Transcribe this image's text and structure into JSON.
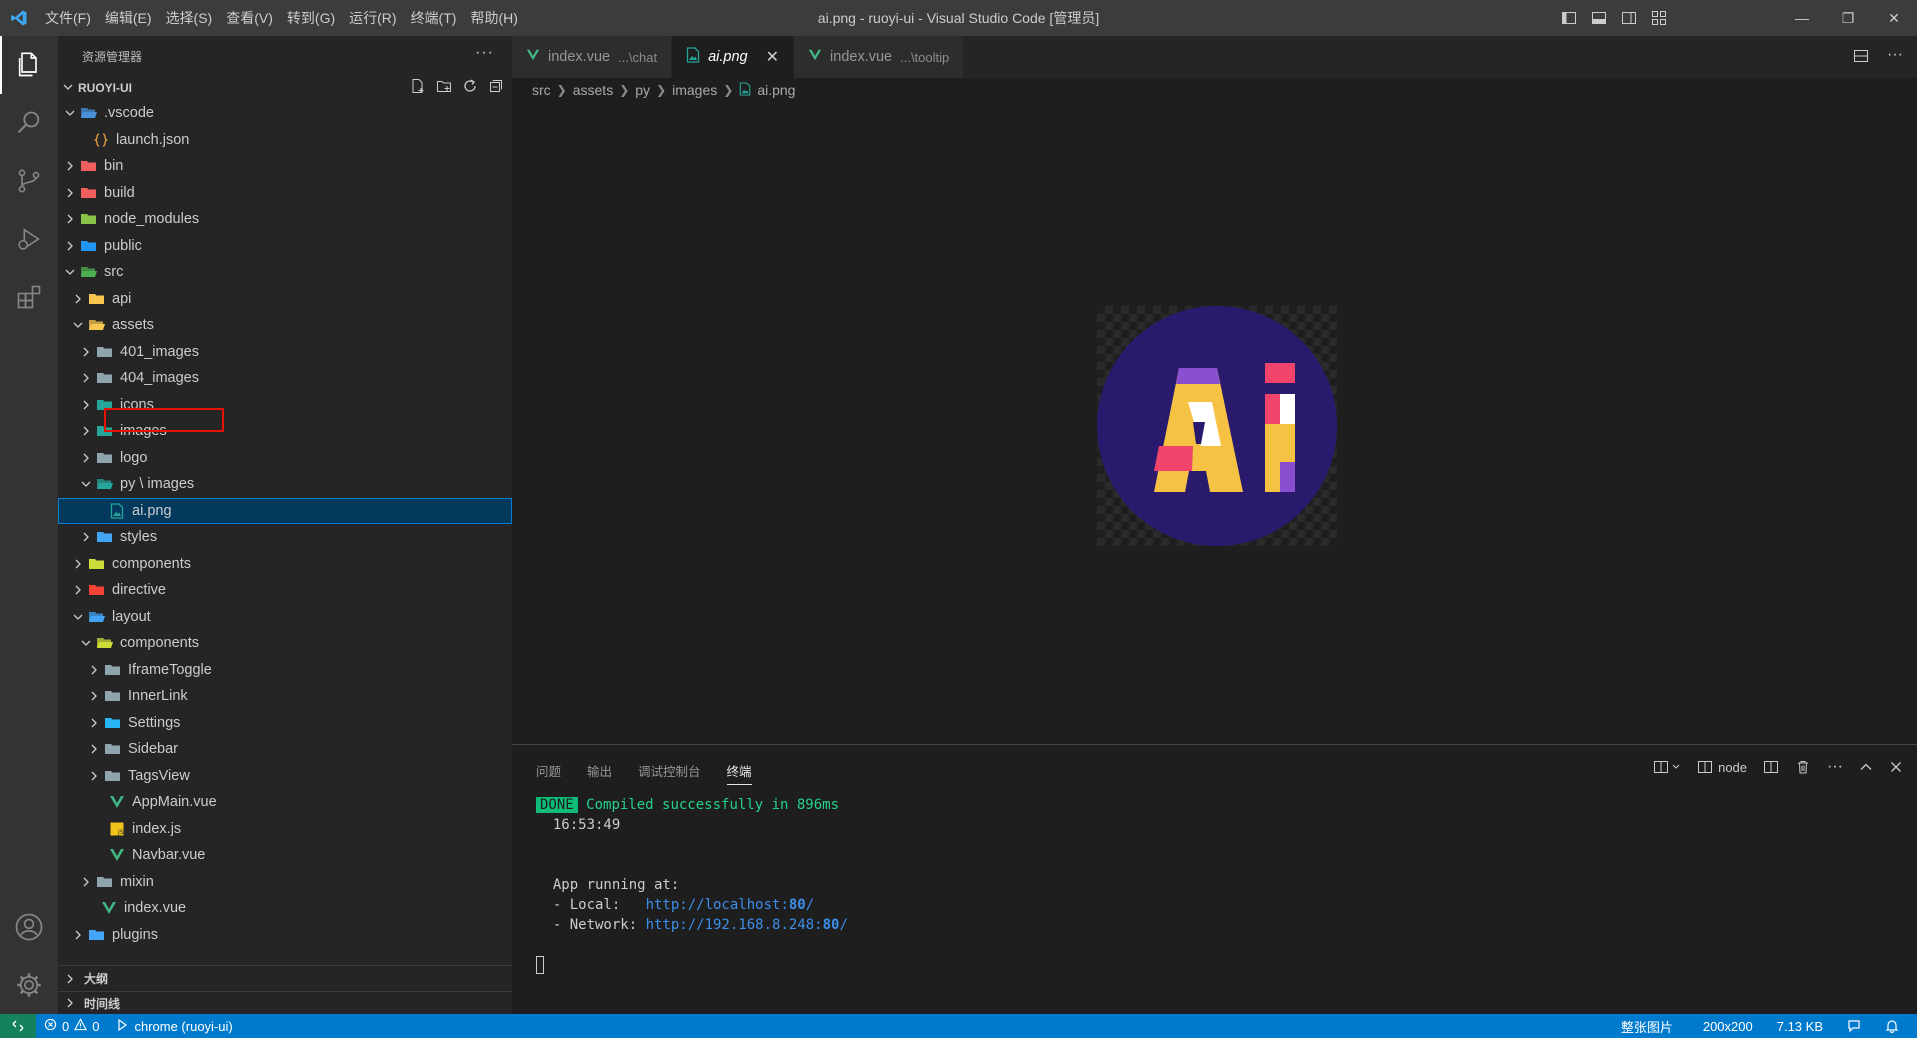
{
  "titlebar": {
    "menu": [
      "文件(F)",
      "编辑(E)",
      "选择(S)",
      "查看(V)",
      "转到(G)",
      "运行(R)",
      "终端(T)",
      "帮助(H)"
    ],
    "title": "ai.png - ruoyi-ui - Visual Studio Code [管理员]"
  },
  "sidebar": {
    "title": "资源管理器",
    "root": "RUOYI-UI",
    "tree": [
      {
        "label": ".vscode",
        "depth": 1,
        "chev": "open",
        "icon": "folder-vscode-icon",
        "color": "#4a90d9"
      },
      {
        "label": "launch.json",
        "depth": 2,
        "chev": "none",
        "icon": "json-braces-icon",
        "color": "#e8a33d"
      },
      {
        "label": "bin",
        "depth": 1,
        "chev": "closed",
        "icon": "folder-bin-icon",
        "color": "#f05e5e"
      },
      {
        "label": "build",
        "depth": 1,
        "chev": "closed",
        "icon": "folder-build-icon",
        "color": "#f05e5e"
      },
      {
        "label": "node_modules",
        "depth": 1,
        "chev": "closed",
        "icon": "folder-node-icon",
        "color": "#8bc34a"
      },
      {
        "label": "public",
        "depth": 1,
        "chev": "closed",
        "icon": "folder-public-icon",
        "color": "#2196f3"
      },
      {
        "label": "src",
        "depth": 1,
        "chev": "open",
        "icon": "folder-src-icon",
        "color": "#4caf50"
      },
      {
        "label": "api",
        "depth": 2,
        "chev": "closed",
        "icon": "folder-api-icon",
        "color": "#f9c74f"
      },
      {
        "label": "assets",
        "depth": 2,
        "chev": "open",
        "icon": "folder-assets-icon",
        "color": "#f9c74f"
      },
      {
        "label": "401_images",
        "depth": 3,
        "chev": "closed",
        "icon": "folder-icon",
        "color": "#90a4ae"
      },
      {
        "label": "404_images",
        "depth": 3,
        "chev": "closed",
        "icon": "folder-icon",
        "color": "#90a4ae"
      },
      {
        "label": "icons",
        "depth": 3,
        "chev": "closed",
        "icon": "folder-images-icon",
        "color": "#26a69a"
      },
      {
        "label": "images",
        "depth": 3,
        "chev": "closed",
        "icon": "folder-images-icon",
        "color": "#26a69a"
      },
      {
        "label": "logo",
        "depth": 3,
        "chev": "closed",
        "icon": "folder-icon",
        "color": "#90a4ae"
      },
      {
        "label": "py \\ images",
        "depth": 3,
        "chev": "open",
        "icon": "folder-images-icon",
        "color": "#26a69a"
      },
      {
        "label": "ai.png",
        "depth": 4,
        "chev": "none",
        "icon": "image-file-icon",
        "color": "#26a69a",
        "selected": true
      },
      {
        "label": "styles",
        "depth": 3,
        "chev": "closed",
        "icon": "folder-styles-icon",
        "color": "#42a5f5"
      },
      {
        "label": "components",
        "depth": 2,
        "chev": "closed",
        "icon": "folder-components-icon",
        "color": "#cddc39"
      },
      {
        "label": "directive",
        "depth": 2,
        "chev": "closed",
        "icon": "folder-directive-icon",
        "color": "#f44336"
      },
      {
        "label": "layout",
        "depth": 2,
        "chev": "open",
        "icon": "folder-layout-icon",
        "color": "#42a5f5"
      },
      {
        "label": "components",
        "depth": 3,
        "chev": "open",
        "icon": "folder-components-icon",
        "color": "#cddc39"
      },
      {
        "label": "IframeToggle",
        "depth": 4,
        "chev": "closed",
        "icon": "folder-icon",
        "color": "#90a4ae"
      },
      {
        "label": "InnerLink",
        "depth": 4,
        "chev": "closed",
        "icon": "folder-icon",
        "color": "#90a4ae"
      },
      {
        "label": "Settings",
        "depth": 4,
        "chev": "closed",
        "icon": "folder-settings-icon",
        "color": "#29b6f6"
      },
      {
        "label": "Sidebar",
        "depth": 4,
        "chev": "closed",
        "icon": "folder-icon",
        "color": "#90a4ae"
      },
      {
        "label": "TagsView",
        "depth": 4,
        "chev": "closed",
        "icon": "folder-icon",
        "color": "#90a4ae"
      },
      {
        "label": "AppMain.vue",
        "depth": 4,
        "chev": "none",
        "icon": "vue-file-icon",
        "color": "#41b883"
      },
      {
        "label": "index.js",
        "depth": 4,
        "chev": "none",
        "icon": "js-file-icon",
        "color": "#f0c419"
      },
      {
        "label": "Navbar.vue",
        "depth": 4,
        "chev": "none",
        "icon": "vue-file-icon",
        "color": "#41b883"
      },
      {
        "label": "mixin",
        "depth": 3,
        "chev": "closed",
        "icon": "folder-icon",
        "color": "#90a4ae"
      },
      {
        "label": "index.vue",
        "depth": 3,
        "chev": "none",
        "icon": "vue-file-icon",
        "color": "#41b883"
      },
      {
        "label": "plugins",
        "depth": 2,
        "chev": "closed",
        "icon": "folder-plugins-icon",
        "color": "#42a5f5"
      }
    ],
    "outline_title": "大纲",
    "timeline_title": "时间线"
  },
  "tabs": [
    {
      "label": "index.vue",
      "hint": "...\\chat",
      "icon": "vue-file-icon",
      "active": false
    },
    {
      "label": "ai.png",
      "hint": "",
      "icon": "image-file-icon",
      "active": true
    },
    {
      "label": "index.vue",
      "hint": "...\\tooltip",
      "icon": "vue-file-icon",
      "active": false
    }
  ],
  "breadcrumb": [
    "src",
    "assets",
    "py",
    "images",
    "ai.png"
  ],
  "panel": {
    "tabs": [
      "问题",
      "输出",
      "调试控制台",
      "终端"
    ],
    "active_tab": "终端",
    "terminal_name": "node",
    "terminal": {
      "done_badge": "DONE",
      "compiled": "Compiled successfully in 896ms",
      "time": "16:53:49",
      "running": "App running at:",
      "local_label": "- Local:   ",
      "local_url": "http://localhost:",
      "local_port": "80",
      "network_label": "- Network: ",
      "network_url": "http://192.168.8.248:",
      "network_port": "80",
      "slash": "/"
    }
  },
  "statusbar": {
    "errors": "0",
    "warnings": "0",
    "debug": "chrome (ruoyi-ui)",
    "image_mode": "整张图片",
    "dimensions": "200x200",
    "size": "7.13 KB"
  },
  "colors": {
    "accent": "#007acc",
    "image_bg": "#2a1a6e",
    "ai_yellow": "#f6c243",
    "ai_pink": "#f0446a",
    "ai_purple": "#8a4fd0"
  }
}
